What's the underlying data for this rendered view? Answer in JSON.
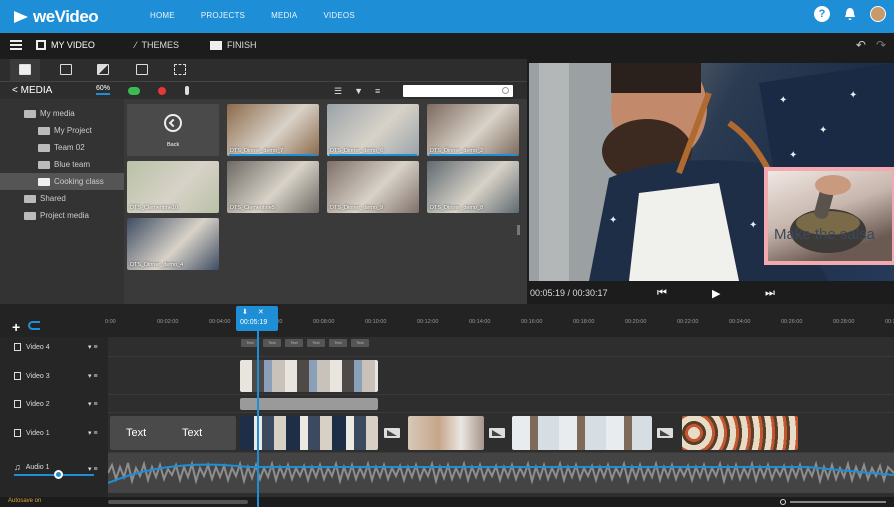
{
  "app": {
    "logo": "weVideo",
    "nav": [
      "HOME",
      "PROJECTS",
      "MEDIA",
      "VIDEOS"
    ],
    "help_label": "?"
  },
  "tabs": {
    "my_video": "MY VIDEO",
    "themes": "THEMES",
    "finish": "FINISH"
  },
  "media": {
    "title": "< MEDIA",
    "storage_percent": "60%",
    "tree": [
      {
        "label": "My media",
        "indent": 0,
        "selected": false
      },
      {
        "label": "My Project",
        "indent": 1,
        "selected": false
      },
      {
        "label": "Team 02",
        "indent": 1,
        "selected": false
      },
      {
        "label": "Blue team",
        "indent": 1,
        "selected": false
      },
      {
        "label": "Cooking class",
        "indent": 1,
        "selected": true
      },
      {
        "label": "Shared",
        "indent": 0,
        "selected": false
      },
      {
        "label": "Project media",
        "indent": 0,
        "selected": false
      }
    ],
    "back_label": "Back",
    "items": [
      {
        "label": "DTS_Dinner_demo_7",
        "color": "#8c6a4a"
      },
      {
        "label": "DTS_Dinner_demo_6",
        "color": "#9aa3a8"
      },
      {
        "label": "DTS_Dinner_demo_2",
        "color": "#7d6a5e"
      },
      {
        "label": "DTS_Clementine10",
        "color": "#b8c2a6"
      },
      {
        "label": "DTS_Clementine5",
        "color": "#6d6a64"
      },
      {
        "label": "DTS_Dinner_demo_9",
        "color": "#7f7068"
      },
      {
        "label": "DTS_Dinner_demo_8",
        "color": "#5f6a70"
      },
      {
        "label": "DTS_Dinner_demo_4",
        "color": "#3e4c63"
      }
    ]
  },
  "preview": {
    "overlay_text": "Make the salsa",
    "time": "00:05:19 / 00:30:17"
  },
  "timeline": {
    "playhead_time": "00:05:19",
    "ticks": [
      "0:00",
      "00:02:00",
      "00:04:00",
      "00:06:00",
      "00:08:00",
      "00:10:00",
      "00:12:00",
      "00:14:00",
      "00:16:00",
      "00:18:00",
      "00:20:00",
      "00:22:00",
      "00:24:00",
      "00:26:00",
      "00:28:00",
      "00:30:00"
    ],
    "tracks": {
      "video4": "Video 4",
      "video3": "Video 3",
      "video2": "Video 2",
      "video1": "Video 1",
      "audio1": "Audio 1"
    },
    "text_chip": "Text",
    "text_clip_a": "Text",
    "text_clip_b": "Text"
  },
  "footer": {
    "status": "Autosave on"
  },
  "colors": {
    "accent": "#1e8fd6",
    "pip_border": "#f4a9b1"
  }
}
